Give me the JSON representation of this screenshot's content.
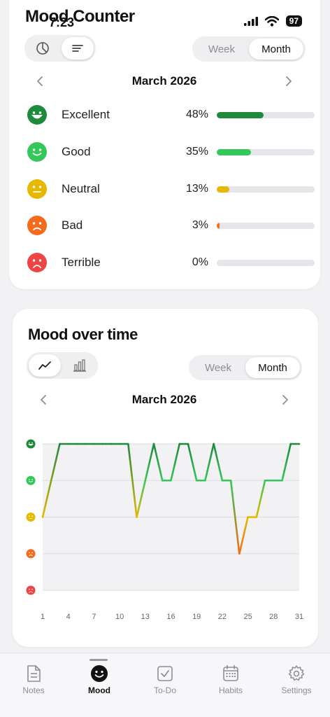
{
  "status": {
    "time": "7:23",
    "battery": "97"
  },
  "app": {
    "title": "Mood Counter"
  },
  "distribution": {
    "range_options": {
      "week": "Week",
      "month": "Month",
      "selected": "Month"
    },
    "month_label": "March 2026",
    "moods": [
      {
        "name": "Excellent",
        "percent_label": "48%",
        "percent": 48,
        "color": "#1e8a3c"
      },
      {
        "name": "Good",
        "percent_label": "35%",
        "percent": 35,
        "color": "#34c759"
      },
      {
        "name": "Neutral",
        "percent_label": "13%",
        "percent": 13,
        "color": "#e6b800"
      },
      {
        "name": "Bad",
        "percent_label": "3%",
        "percent": 3,
        "color": "#f46b1c"
      },
      {
        "name": "Terrible",
        "percent_label": "0%",
        "percent": 0,
        "color": "#ee4444"
      }
    ]
  },
  "timeline": {
    "title": "Mood over time",
    "range_options": {
      "week": "Week",
      "month": "Month",
      "selected": "Month"
    },
    "month_label": "March 2026"
  },
  "chart_data": {
    "type": "line",
    "x_ticks": [
      "1",
      "4",
      "7",
      "10",
      "13",
      "16",
      "19",
      "22",
      "25",
      "28",
      "31"
    ],
    "y_levels": [
      "Terrible",
      "Bad",
      "Neutral",
      "Good",
      "Excellent"
    ],
    "ylim": [
      1,
      5
    ],
    "xlim": [
      1,
      31
    ],
    "x": [
      1,
      3,
      4,
      5,
      6,
      7,
      8,
      9,
      10,
      11,
      12,
      13,
      14,
      15,
      16,
      17,
      18,
      19,
      20,
      21,
      22,
      23,
      24,
      25,
      26,
      27,
      28,
      29,
      30,
      31
    ],
    "y": [
      3,
      5,
      5,
      5,
      5,
      5,
      5,
      5,
      5,
      5,
      3,
      4,
      5,
      4,
      4,
      5,
      5,
      4,
      4,
      5,
      4,
      4,
      2,
      3,
      3,
      4,
      4,
      4,
      5,
      5
    ],
    "colors": {
      "1": "#ee4444",
      "2": "#f46b1c",
      "3": "#e6b800",
      "4": "#34c759",
      "5": "#1e8a3c"
    },
    "grid": true
  },
  "tabs": [
    {
      "label": "Notes",
      "icon": "notes-icon"
    },
    {
      "label": "Mood",
      "icon": "mood-icon",
      "active": true
    },
    {
      "label": "To-Do",
      "icon": "todo-icon"
    },
    {
      "label": "Habits",
      "icon": "habits-icon"
    },
    {
      "label": "Settings",
      "icon": "settings-icon"
    }
  ]
}
